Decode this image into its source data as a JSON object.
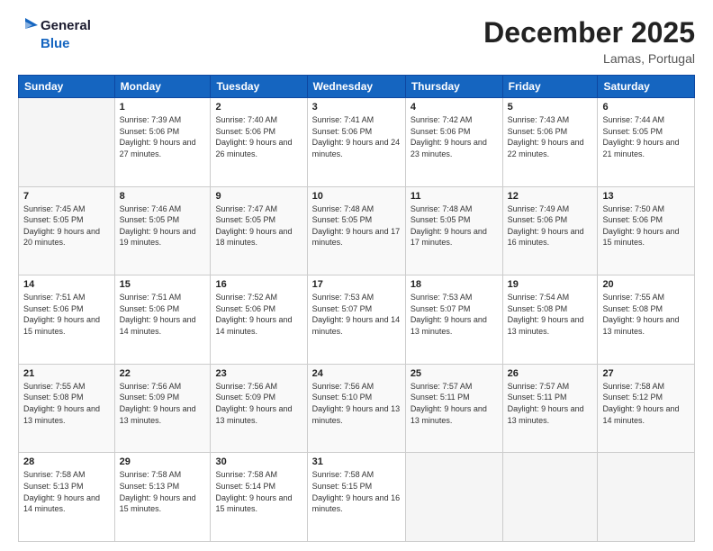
{
  "logo": {
    "line1": "General",
    "line2": "Blue"
  },
  "header": {
    "month": "December 2025",
    "location": "Lamas, Portugal"
  },
  "weekdays": [
    "Sunday",
    "Monday",
    "Tuesday",
    "Wednesday",
    "Thursday",
    "Friday",
    "Saturday"
  ],
  "weeks": [
    [
      {
        "day": "",
        "sunrise": "",
        "sunset": "",
        "daylight": ""
      },
      {
        "day": "1",
        "sunrise": "Sunrise: 7:39 AM",
        "sunset": "Sunset: 5:06 PM",
        "daylight": "Daylight: 9 hours and 27 minutes."
      },
      {
        "day": "2",
        "sunrise": "Sunrise: 7:40 AM",
        "sunset": "Sunset: 5:06 PM",
        "daylight": "Daylight: 9 hours and 26 minutes."
      },
      {
        "day": "3",
        "sunrise": "Sunrise: 7:41 AM",
        "sunset": "Sunset: 5:06 PM",
        "daylight": "Daylight: 9 hours and 24 minutes."
      },
      {
        "day": "4",
        "sunrise": "Sunrise: 7:42 AM",
        "sunset": "Sunset: 5:06 PM",
        "daylight": "Daylight: 9 hours and 23 minutes."
      },
      {
        "day": "5",
        "sunrise": "Sunrise: 7:43 AM",
        "sunset": "Sunset: 5:06 PM",
        "daylight": "Daylight: 9 hours and 22 minutes."
      },
      {
        "day": "6",
        "sunrise": "Sunrise: 7:44 AM",
        "sunset": "Sunset: 5:05 PM",
        "daylight": "Daylight: 9 hours and 21 minutes."
      }
    ],
    [
      {
        "day": "7",
        "sunrise": "Sunrise: 7:45 AM",
        "sunset": "Sunset: 5:05 PM",
        "daylight": "Daylight: 9 hours and 20 minutes."
      },
      {
        "day": "8",
        "sunrise": "Sunrise: 7:46 AM",
        "sunset": "Sunset: 5:05 PM",
        "daylight": "Daylight: 9 hours and 19 minutes."
      },
      {
        "day": "9",
        "sunrise": "Sunrise: 7:47 AM",
        "sunset": "Sunset: 5:05 PM",
        "daylight": "Daylight: 9 hours and 18 minutes."
      },
      {
        "day": "10",
        "sunrise": "Sunrise: 7:48 AM",
        "sunset": "Sunset: 5:05 PM",
        "daylight": "Daylight: 9 hours and 17 minutes."
      },
      {
        "day": "11",
        "sunrise": "Sunrise: 7:48 AM",
        "sunset": "Sunset: 5:05 PM",
        "daylight": "Daylight: 9 hours and 17 minutes."
      },
      {
        "day": "12",
        "sunrise": "Sunrise: 7:49 AM",
        "sunset": "Sunset: 5:06 PM",
        "daylight": "Daylight: 9 hours and 16 minutes."
      },
      {
        "day": "13",
        "sunrise": "Sunrise: 7:50 AM",
        "sunset": "Sunset: 5:06 PM",
        "daylight": "Daylight: 9 hours and 15 minutes."
      }
    ],
    [
      {
        "day": "14",
        "sunrise": "Sunrise: 7:51 AM",
        "sunset": "Sunset: 5:06 PM",
        "daylight": "Daylight: 9 hours and 15 minutes."
      },
      {
        "day": "15",
        "sunrise": "Sunrise: 7:51 AM",
        "sunset": "Sunset: 5:06 PM",
        "daylight": "Daylight: 9 hours and 14 minutes."
      },
      {
        "day": "16",
        "sunrise": "Sunrise: 7:52 AM",
        "sunset": "Sunset: 5:06 PM",
        "daylight": "Daylight: 9 hours and 14 minutes."
      },
      {
        "day": "17",
        "sunrise": "Sunrise: 7:53 AM",
        "sunset": "Sunset: 5:07 PM",
        "daylight": "Daylight: 9 hours and 14 minutes."
      },
      {
        "day": "18",
        "sunrise": "Sunrise: 7:53 AM",
        "sunset": "Sunset: 5:07 PM",
        "daylight": "Daylight: 9 hours and 13 minutes."
      },
      {
        "day": "19",
        "sunrise": "Sunrise: 7:54 AM",
        "sunset": "Sunset: 5:08 PM",
        "daylight": "Daylight: 9 hours and 13 minutes."
      },
      {
        "day": "20",
        "sunrise": "Sunrise: 7:55 AM",
        "sunset": "Sunset: 5:08 PM",
        "daylight": "Daylight: 9 hours and 13 minutes."
      }
    ],
    [
      {
        "day": "21",
        "sunrise": "Sunrise: 7:55 AM",
        "sunset": "Sunset: 5:08 PM",
        "daylight": "Daylight: 9 hours and 13 minutes."
      },
      {
        "day": "22",
        "sunrise": "Sunrise: 7:56 AM",
        "sunset": "Sunset: 5:09 PM",
        "daylight": "Daylight: 9 hours and 13 minutes."
      },
      {
        "day": "23",
        "sunrise": "Sunrise: 7:56 AM",
        "sunset": "Sunset: 5:09 PM",
        "daylight": "Daylight: 9 hours and 13 minutes."
      },
      {
        "day": "24",
        "sunrise": "Sunrise: 7:56 AM",
        "sunset": "Sunset: 5:10 PM",
        "daylight": "Daylight: 9 hours and 13 minutes."
      },
      {
        "day": "25",
        "sunrise": "Sunrise: 7:57 AM",
        "sunset": "Sunset: 5:11 PM",
        "daylight": "Daylight: 9 hours and 13 minutes."
      },
      {
        "day": "26",
        "sunrise": "Sunrise: 7:57 AM",
        "sunset": "Sunset: 5:11 PM",
        "daylight": "Daylight: 9 hours and 13 minutes."
      },
      {
        "day": "27",
        "sunrise": "Sunrise: 7:58 AM",
        "sunset": "Sunset: 5:12 PM",
        "daylight": "Daylight: 9 hours and 14 minutes."
      }
    ],
    [
      {
        "day": "28",
        "sunrise": "Sunrise: 7:58 AM",
        "sunset": "Sunset: 5:13 PM",
        "daylight": "Daylight: 9 hours and 14 minutes."
      },
      {
        "day": "29",
        "sunrise": "Sunrise: 7:58 AM",
        "sunset": "Sunset: 5:13 PM",
        "daylight": "Daylight: 9 hours and 15 minutes."
      },
      {
        "day": "30",
        "sunrise": "Sunrise: 7:58 AM",
        "sunset": "Sunset: 5:14 PM",
        "daylight": "Daylight: 9 hours and 15 minutes."
      },
      {
        "day": "31",
        "sunrise": "Sunrise: 7:58 AM",
        "sunset": "Sunset: 5:15 PM",
        "daylight": "Daylight: 9 hours and 16 minutes."
      },
      {
        "day": "",
        "sunrise": "",
        "sunset": "",
        "daylight": ""
      },
      {
        "day": "",
        "sunrise": "",
        "sunset": "",
        "daylight": ""
      },
      {
        "day": "",
        "sunrise": "",
        "sunset": "",
        "daylight": ""
      }
    ]
  ]
}
